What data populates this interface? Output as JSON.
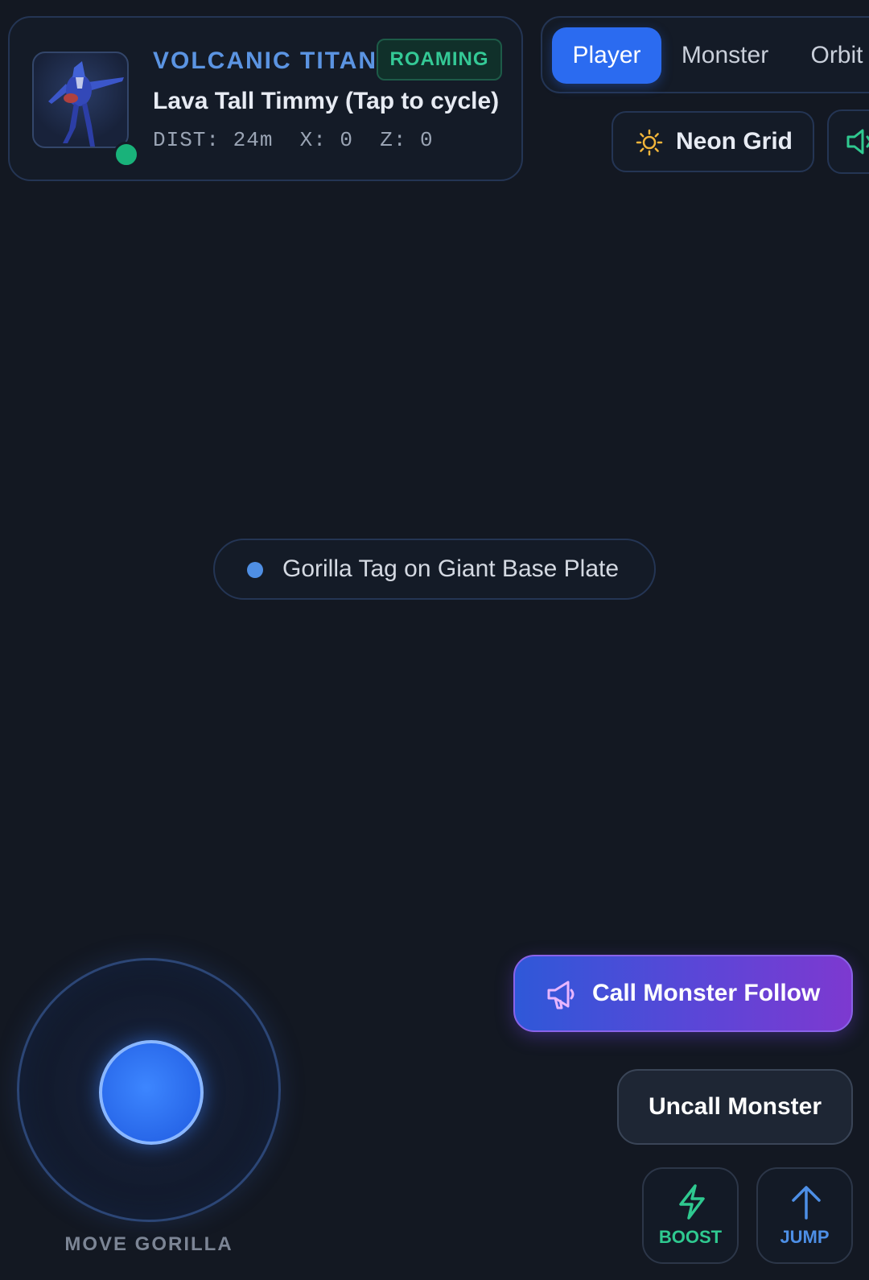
{
  "monster_card": {
    "title": "VOLCANIC TITAN",
    "status": "ROAMING",
    "name": "Lava Tall Timmy (Tap to cycle)",
    "coords": "DIST: 24m  X: 0  Z: 0"
  },
  "camera_tabs": [
    {
      "label": "Player",
      "active": true
    },
    {
      "label": "Monster",
      "active": false
    },
    {
      "label": "Orbit",
      "active": false
    }
  ],
  "theme": {
    "label": "Neon Grid",
    "icon": "sun-icon"
  },
  "sound": {
    "icon": "speaker-icon"
  },
  "map": {
    "label": "Gorilla Tag on Giant Base Plate"
  },
  "joystick": {
    "label": "MOVE GORILLA"
  },
  "actions": {
    "call_label": "Call Monster Follow",
    "uncall_label": "Uncall Monster",
    "boost_label": "BOOST",
    "jump_label": "JUMP"
  },
  "colors": {
    "background": "#131822",
    "accent_blue": "#2b6bf0",
    "status_green": "#34c996",
    "title_blue": "#5b94e2",
    "call_gradient_start": "#2f58d8",
    "call_gradient_end": "#7d39d0"
  }
}
